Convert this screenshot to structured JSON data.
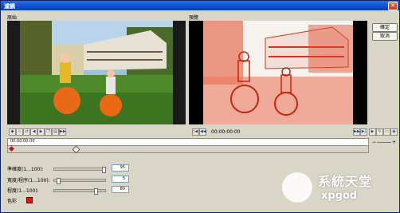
{
  "window": {
    "title": "濾鏡",
    "close_glyph": "✕"
  },
  "panels": {
    "original_label": "原始",
    "preview_label": "預覽"
  },
  "buttons": {
    "ok": "確定",
    "cancel": "取消"
  },
  "preview_time": "00:00:00:00",
  "timeline_time": "00:00:00:00",
  "timeline_minus": "−",
  "timeline_plus": "+",
  "toolbar_icons": [
    "key-add-icon",
    "key-delete-icon",
    "key-reverse-icon",
    "key-prev-icon",
    "key-next-icon",
    "key-copy-icon",
    "key-paste-icon",
    "key-end-icon"
  ],
  "sliders": [
    {
      "label": "準確度(1...100):",
      "value": "95",
      "level": 0.95
    },
    {
      "label": "寬度/程序(1...100):",
      "value": "5",
      "level": 0.05
    },
    {
      "label": "程度(1...100):",
      "value": "80",
      "level": 0.8
    }
  ],
  "color_label": "色彩",
  "color_value": "#e8120c",
  "watermark": {
    "line1": "系統天堂",
    "line2": "xpgod"
  }
}
